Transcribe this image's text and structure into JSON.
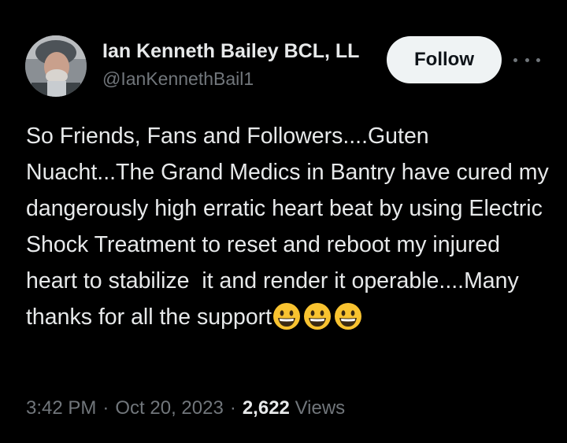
{
  "author": {
    "display_name": "Ian Kenneth Bailey BCL, LL",
    "handle": "@IanKennethBail1"
  },
  "header": {
    "follow_label": "Follow",
    "more_icon": "more-horizontal-icon"
  },
  "tweet": {
    "text": "So Friends, Fans and Followers....Guten Nuacht...The Grand Medics in Bantry have cured my dangerously high erratic heart beat by using Electric Shock Treatment to reset and reboot my injured heart to stabilize  it and render it operable....Many thanks for all the support",
    "emojis": [
      "grinning-face-icon",
      "grinning-face-icon",
      "grinning-face-icon"
    ]
  },
  "meta": {
    "time": "3:42 PM",
    "separator": "·",
    "date": "Oct 20, 2023",
    "views_count": "2,622",
    "views_label": "Views"
  },
  "colors": {
    "background": "#000000",
    "primary_text": "#e7e9ea",
    "secondary_text": "#71767b",
    "follow_bg": "#eff3f4",
    "follow_text": "#0f1419",
    "emoji_face": "#f9c330"
  }
}
